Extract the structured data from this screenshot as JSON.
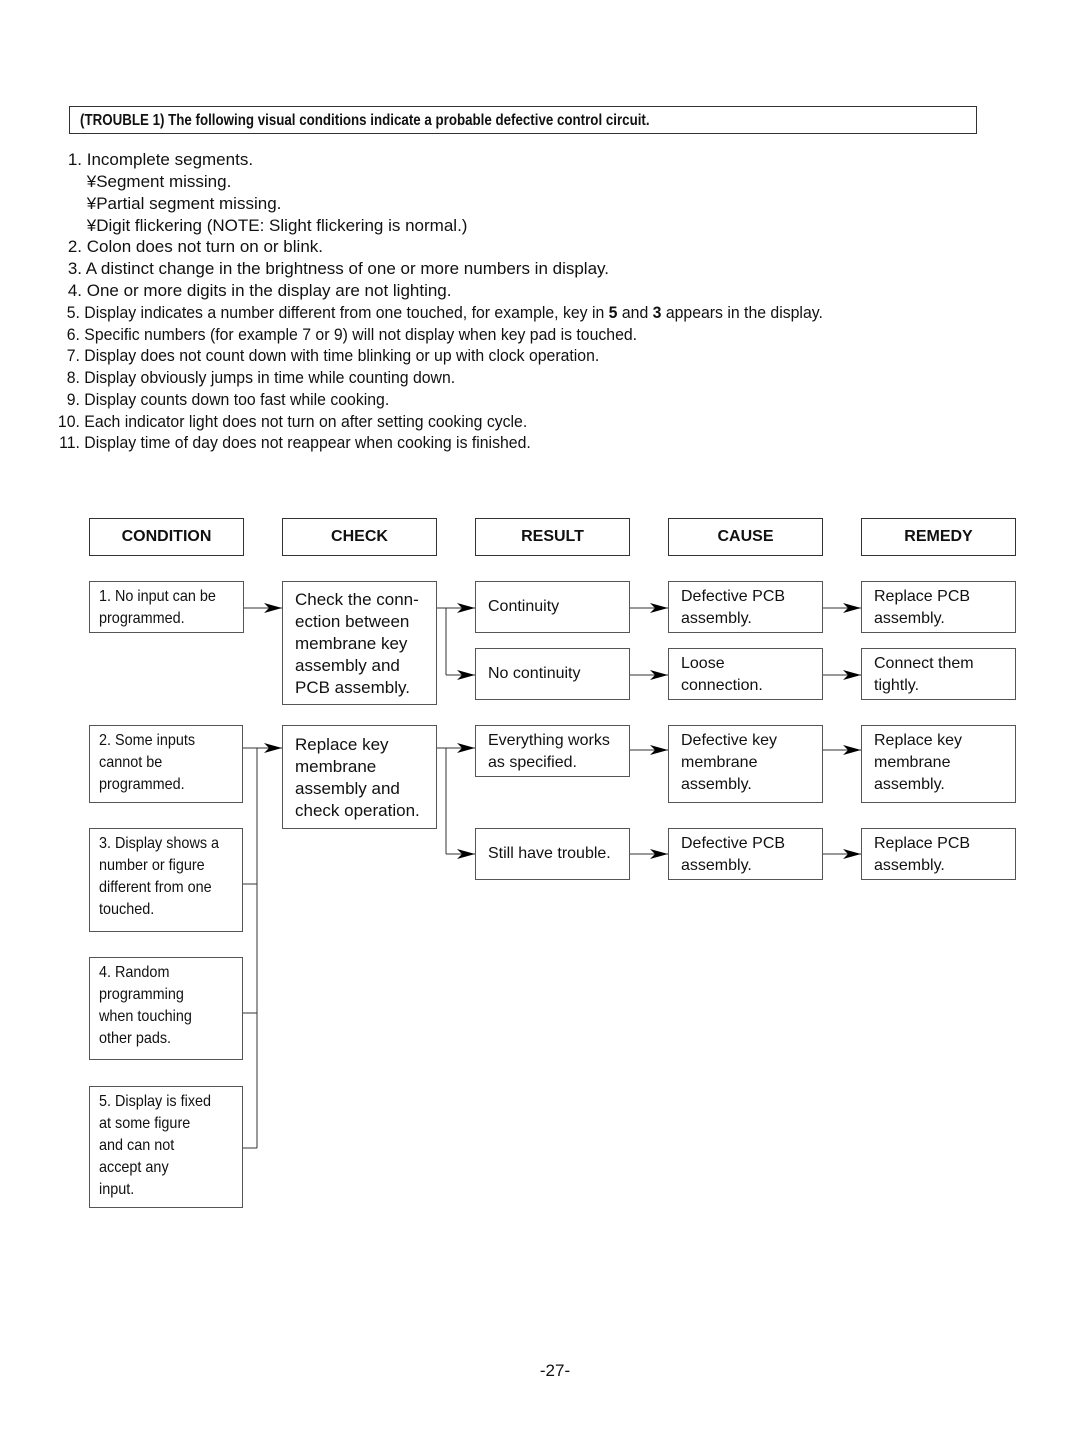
{
  "banner": "(TROUBLE 1) The following visual conditions indicate a probable defective control circuit.",
  "conditions_list": [
    {
      "num": "1.",
      "text": "Incomplete segments."
    },
    {
      "num": "",
      "text": "¥Segment missing."
    },
    {
      "num": "",
      "text": "¥Partial segment missing."
    },
    {
      "num": "",
      "text": "¥Digit flickering (NOTE: Slight flickering is normal.)"
    },
    {
      "num": "2.",
      "text": "Colon does not turn on or blink."
    },
    {
      "num": "3.",
      "text": "A distinct change in the brightness of one or more numbers in display."
    },
    {
      "num": "4.",
      "text": "One or more digits in the display are not lighting."
    },
    {
      "num": "5.",
      "text_a": "Display indicates a number different from one touched, for example, key in ",
      "bold_a": "5",
      "text_b": " and ",
      "bold_b": "3",
      "text_c": " appears in the display."
    },
    {
      "num": "6.",
      "text": "Specific numbers (for example 7 or 9) will not display when key pad is touched."
    },
    {
      "num": "7.",
      "text": "Display does not count down with time blinking or up with clock operation."
    },
    {
      "num": "8.",
      "text": "Display obviously jumps in time while counting down."
    },
    {
      "num": "9.",
      "text": "Display counts down too fast while cooking."
    },
    {
      "num": "10.",
      "text": "Each indicator light does not turn on after setting cooking cycle."
    },
    {
      "num": "11.",
      "text": "Display time of day does not reappear when cooking is finished."
    }
  ],
  "flow": {
    "headers": [
      "CONDITION",
      "CHECK",
      "RESULT",
      "CAUSE",
      "REMEDY"
    ],
    "conditions": [
      "1. No input can be\n    programmed.",
      "2. Some inputs\n    cannot be\n    programmed.",
      "3. Display shows a\n    number or figure\n    different from one\n    touched.",
      "4. Random\n    programming\n    when touching\n    other pads.",
      "5. Display is fixed\n    at some figure\n    and can not\n    accept any\n    input."
    ],
    "checks": [
      "Check the conn-\nection between\nmembrane key\nassembly and\nPCB assembly.",
      "Replace key\nmembrane\nassembly and\ncheck operation."
    ],
    "results": [
      "Continuity",
      "No continuity",
      "Everything works\nas specified.",
      "Still have trouble."
    ],
    "causes": [
      "Defective PCB\nassembly.",
      "Loose\nconnection.",
      "Defective key\nmembrane\nassembly.",
      "Defective PCB\nassembly."
    ],
    "remedies": [
      "Replace PCB\nassembly.",
      "Connect them\ntightly.",
      "Replace key\nmembrane\nassembly.",
      "Replace PCB\nassembly."
    ]
  },
  "page_number": "-27-"
}
